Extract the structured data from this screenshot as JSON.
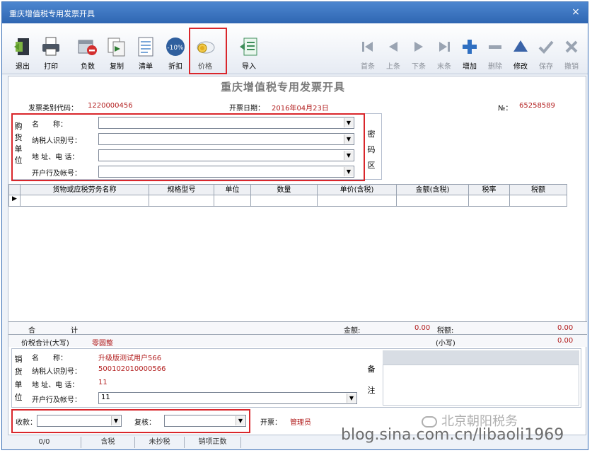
{
  "window": {
    "title": "重庆增值税专用发票开具",
    "close_glyph": "×"
  },
  "toolbar": {
    "left": [
      {
        "label": "退出",
        "icon": "exit-icon"
      },
      {
        "label": "打印",
        "icon": "printer-icon"
      },
      {
        "label": "负数",
        "icon": "negative-icon"
      },
      {
        "label": "复制",
        "icon": "copy-icon"
      },
      {
        "label": "清单",
        "icon": "list-icon"
      },
      {
        "label": "折扣",
        "icon": "discount-icon",
        "badge": "-10%"
      },
      {
        "label": "价格",
        "icon": "price-icon"
      },
      {
        "label": "导入",
        "icon": "import-icon"
      }
    ],
    "right": [
      {
        "label": "首条",
        "icon": "first-icon"
      },
      {
        "label": "上条",
        "icon": "prev-icon"
      },
      {
        "label": "下条",
        "icon": "next-icon"
      },
      {
        "label": "末条",
        "icon": "last-icon"
      },
      {
        "label": "增加",
        "icon": "add-icon"
      },
      {
        "label": "删除",
        "icon": "delete-icon"
      },
      {
        "label": "修改",
        "icon": "edit-icon"
      },
      {
        "label": "保存",
        "icon": "save-icon"
      },
      {
        "label": "撤销",
        "icon": "undo-icon"
      }
    ]
  },
  "form": {
    "heading": "重庆增值税专用发票开具",
    "invoice_code_label": "发票类别代码：",
    "invoice_code": "1220000456",
    "date_label": "开票日期：",
    "date": "2016年04月23日",
    "no_label": "№：",
    "no": "65258589",
    "buyer": {
      "side_label": [
        "购",
        "货",
        "单",
        "位"
      ],
      "fields": [
        {
          "label": "名　　称：",
          "value": ""
        },
        {
          "label": "纳税人识别号：",
          "value": ""
        },
        {
          "label": "地 址、电 话：",
          "value": ""
        },
        {
          "label": "开户行及帐号：",
          "value": ""
        }
      ]
    },
    "cipher_label": [
      "密",
      "码",
      "区"
    ],
    "table": {
      "columns": [
        "货物或应税劳务名称",
        "规格型号",
        "单位",
        "数量",
        "单价(含税)",
        "金额(含税)",
        "税率",
        "税额"
      ],
      "row_marker": "▶"
    },
    "totals": {
      "label_he": "合",
      "label_ji": "计",
      "amount_label": "金额:",
      "amount": "0.00",
      "tax_label": "税额:",
      "tax": "0.00",
      "sum_label": "价税合计(大写)",
      "sum_upper": "零圆整",
      "small_label": "(小写)",
      "small": "0.00"
    },
    "seller": {
      "side_label": [
        "销",
        "货",
        "单",
        "位"
      ],
      "fields": [
        {
          "label": "名　　称：",
          "value": "升级版测试用户566"
        },
        {
          "label": "纳税人识别号：",
          "value": "500102010000566"
        },
        {
          "label": "地 址、电 话：",
          "value": "11"
        },
        {
          "label": "开户行及帐号：",
          "value": "11"
        }
      ]
    },
    "remark_label": [
      "备",
      "注"
    ],
    "payee_label": "收款：",
    "reviewer_label": "复核：",
    "drawer_label": "开票：",
    "drawer": "管理员"
  },
  "statusbar": [
    "0/0",
    "含税",
    "未抄税",
    "销项正数"
  ],
  "watermark": {
    "wechat": "北京朝阳税务",
    "blog": "blog.sina.com.cn/libaoli1969"
  }
}
